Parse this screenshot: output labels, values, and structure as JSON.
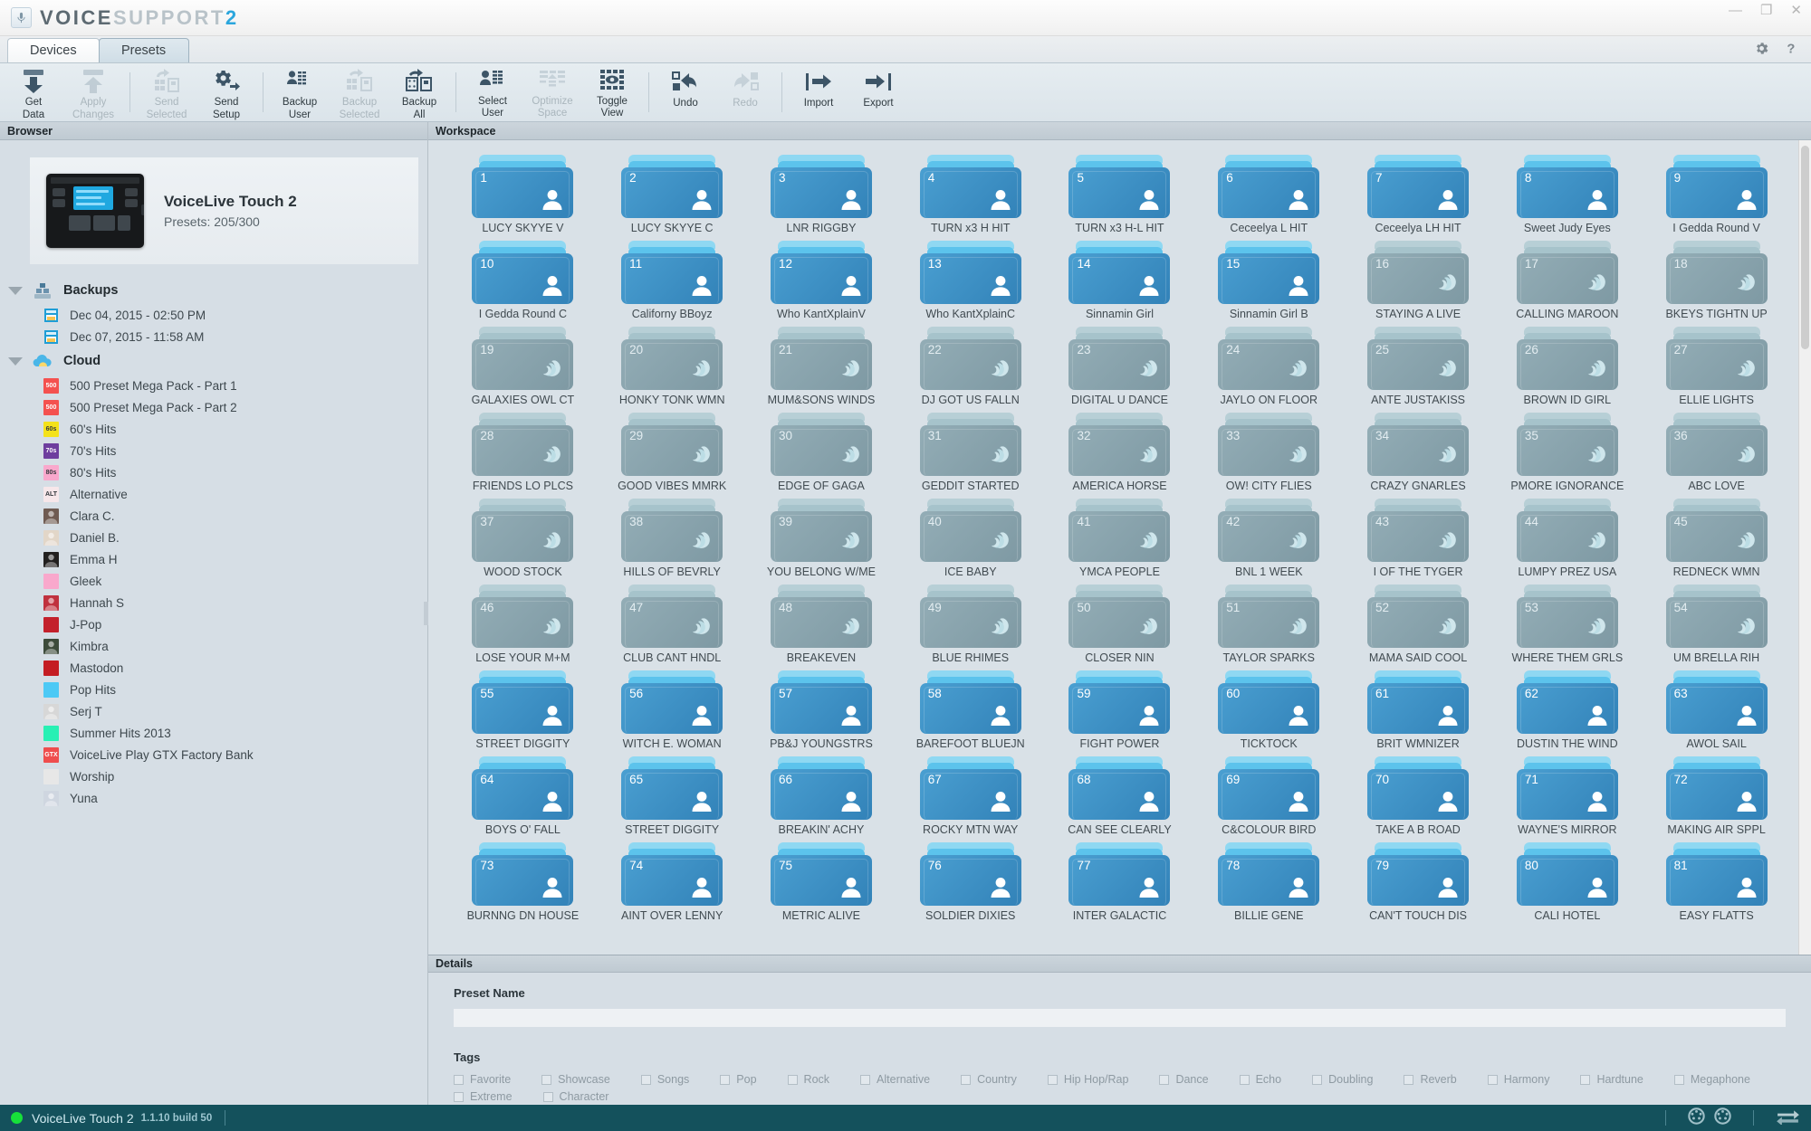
{
  "window": {
    "brand_part1": "VOICE",
    "brand_part2": "SUPPORT",
    "brand_part3": "2",
    "minimize": "—",
    "maximize": "❐",
    "close": "✕",
    "settings_icon": "gear-icon",
    "help_icon": "question-icon"
  },
  "tabs": [
    {
      "label": "Devices",
      "active": false
    },
    {
      "label": "Presets",
      "active": true
    }
  ],
  "toolbar": [
    {
      "label": "Get\nData",
      "line1": "Get",
      "line2": "Data",
      "icon": "download-icon",
      "disabled": false
    },
    {
      "label": "Apply Changes",
      "line1": "Apply",
      "line2": "Changes",
      "icon": "upload-icon",
      "disabled": true
    },
    {
      "sep": true
    },
    {
      "line1": "Send",
      "line2": "Selected",
      "icon": "send-selected-icon",
      "disabled": true
    },
    {
      "line1": "Send",
      "line2": "Setup",
      "icon": "send-setup-gear-icon",
      "disabled": false
    },
    {
      "sep": true
    },
    {
      "line1": "Backup",
      "line2": "User",
      "icon": "backup-user-icon",
      "disabled": false
    },
    {
      "line1": "Backup",
      "line2": "Selected",
      "icon": "backup-selected-icon",
      "disabled": true
    },
    {
      "line1": "Backup",
      "line2": "All",
      "icon": "backup-all-icon",
      "disabled": false
    },
    {
      "sep": true
    },
    {
      "line1": "Select",
      "line2": "User",
      "icon": "select-user-icon",
      "disabled": false
    },
    {
      "line1": "Optimize",
      "line2": "Space",
      "icon": "optimize-space-icon",
      "disabled": true
    },
    {
      "line1": "Toggle",
      "line2": "View",
      "icon": "toggle-view-eye-icon",
      "disabled": false
    },
    {
      "sep": true
    },
    {
      "line1": "Undo",
      "line2": "",
      "icon": "undo-icon",
      "disabled": false
    },
    {
      "line1": "Redo",
      "line2": "",
      "icon": "redo-icon",
      "disabled": true
    },
    {
      "sep": true
    },
    {
      "line1": "Import",
      "line2": "",
      "icon": "import-icon",
      "disabled": false
    },
    {
      "line1": "Export",
      "line2": "",
      "icon": "export-icon",
      "disabled": false
    }
  ],
  "browser": {
    "title": "Browser",
    "device": {
      "name": "VoiceLive Touch 2",
      "presets": "Presets: 205/300"
    },
    "groups": [
      {
        "name": "Backups",
        "icon": "backups-icon",
        "items": [
          {
            "label": "Dec 04, 2015 - 02:50 PM",
            "icon": "backup-file-icon",
            "color": "#2b9fd6"
          },
          {
            "label": "Dec 07, 2015 - 11:58 AM",
            "icon": "backup-file-icon",
            "color": "#2b9fd6"
          }
        ]
      },
      {
        "name": "Cloud",
        "icon": "cloud-icon",
        "items": [
          {
            "label": "500 Preset Mega Pack - Part 1",
            "icon": "pack-thumbnail",
            "color": "#f4514f",
            "text": "500"
          },
          {
            "label": "500 Preset Mega Pack - Part 2",
            "icon": "pack-thumbnail",
            "color": "#f4514f",
            "text": "500"
          },
          {
            "label": "60's Hits",
            "icon": "pack-thumbnail",
            "color": "#f4e21a",
            "text": "60s"
          },
          {
            "label": "70's Hits",
            "icon": "pack-thumbnail",
            "color": "#6e3e9e",
            "text": "70s"
          },
          {
            "label": "80's Hits",
            "icon": "pack-thumbnail",
            "color": "#f9a8cc",
            "text": "80s"
          },
          {
            "label": "Alternative",
            "icon": "pack-thumbnail",
            "color": "#f7e7ea",
            "text": "ALT"
          },
          {
            "label": "Clara C.",
            "icon": "artist-thumbnail",
            "color": "#6f5b52",
            "text": ""
          },
          {
            "label": "Daniel B.",
            "icon": "artist-thumbnail",
            "color": "#e2d6c8",
            "text": ""
          },
          {
            "label": "Emma H",
            "icon": "artist-thumbnail",
            "color": "#22201f",
            "text": ""
          },
          {
            "label": "Gleek",
            "icon": "pack-thumbnail",
            "color": "#f9a8cc",
            "text": ""
          },
          {
            "label": "Hannah S",
            "icon": "artist-thumbnail",
            "color": "#c0313e",
            "text": ""
          },
          {
            "label": "J-Pop",
            "icon": "pack-thumbnail",
            "color": "#c3202b",
            "text": ""
          },
          {
            "label": "Kimbra",
            "icon": "artist-thumbnail",
            "color": "#3d4b3b",
            "text": ""
          },
          {
            "label": "Mastodon",
            "icon": "pack-thumbnail",
            "color": "#c41d23",
            "text": ""
          },
          {
            "label": "Pop Hits",
            "icon": "pack-thumbnail",
            "color": "#4cc9f5",
            "text": ""
          },
          {
            "label": "Serj T",
            "icon": "artist-thumbnail",
            "color": "#d7d7d7",
            "text": ""
          },
          {
            "label": "Summer Hits 2013",
            "icon": "pack-thumbnail",
            "color": "#27f0b4",
            "text": ""
          },
          {
            "label": "VoiceLive Play GTX Factory Bank",
            "icon": "pack-thumbnail",
            "color": "#ef4d4d",
            "text": "GTX"
          },
          {
            "label": "Worship",
            "icon": "pack-thumbnail",
            "color": "#e7e7e7",
            "text": ""
          },
          {
            "label": "Yuna",
            "icon": "artist-thumbnail",
            "color": "#cfd6e0",
            "text": ""
          }
        ]
      }
    ]
  },
  "workspace": {
    "title": "Workspace",
    "user_icon": "person-icon",
    "factory_icon": "wave-disc-icon",
    "presets": [
      {
        "n": "1",
        "name": "LUCY SKYYE V",
        "type": "user"
      },
      {
        "n": "2",
        "name": "LUCY SKYYE C",
        "type": "user"
      },
      {
        "n": "3",
        "name": "LNR RIGGBY",
        "type": "user"
      },
      {
        "n": "4",
        "name": "TURN x3 H HIT",
        "type": "user"
      },
      {
        "n": "5",
        "name": "TURN x3 H-L HIT",
        "type": "user"
      },
      {
        "n": "6",
        "name": "Ceceelya L HIT",
        "type": "user"
      },
      {
        "n": "7",
        "name": "Ceceelya LH HIT",
        "type": "user"
      },
      {
        "n": "8",
        "name": "Sweet Judy Eyes",
        "type": "user"
      },
      {
        "n": "9",
        "name": "I Gedda Round V",
        "type": "user"
      },
      {
        "n": "10",
        "name": "I Gedda Round C",
        "type": "user"
      },
      {
        "n": "11",
        "name": "Californy BBoyz",
        "type": "user"
      },
      {
        "n": "12",
        "name": "Who KantXplainV",
        "type": "user"
      },
      {
        "n": "13",
        "name": "Who KantXplainC",
        "type": "user"
      },
      {
        "n": "14",
        "name": "Sinnamin Girl",
        "type": "user"
      },
      {
        "n": "15",
        "name": "Sinnamin Girl B",
        "type": "user"
      },
      {
        "n": "16",
        "name": "STAYING A LIVE",
        "type": "factory"
      },
      {
        "n": "17",
        "name": "CALLING MAROON",
        "type": "factory"
      },
      {
        "n": "18",
        "name": "BKEYS TIGHTN UP",
        "type": "factory"
      },
      {
        "n": "19",
        "name": "GALAXIES OWL CT",
        "type": "factory"
      },
      {
        "n": "20",
        "name": "HONKY TONK WMN",
        "type": "factory"
      },
      {
        "n": "21",
        "name": "MUM&SONS WINDS",
        "type": "factory"
      },
      {
        "n": "22",
        "name": "DJ GOT US FALLN",
        "type": "factory"
      },
      {
        "n": "23",
        "name": "DIGITAL U DANCE",
        "type": "factory"
      },
      {
        "n": "24",
        "name": "JAYLO ON FLOOR",
        "type": "factory"
      },
      {
        "n": "25",
        "name": "ANTE JUSTAKISS",
        "type": "factory"
      },
      {
        "n": "26",
        "name": "BROWN ID GIRL",
        "type": "factory"
      },
      {
        "n": "27",
        "name": "ELLIE LIGHTS",
        "type": "factory"
      },
      {
        "n": "28",
        "name": "FRIENDS LO PLCS",
        "type": "factory"
      },
      {
        "n": "29",
        "name": "GOOD VIBES MMRK",
        "type": "factory"
      },
      {
        "n": "30",
        "name": "EDGE OF GAGA",
        "type": "factory"
      },
      {
        "n": "31",
        "name": "GEDDIT STARTED",
        "type": "factory"
      },
      {
        "n": "32",
        "name": "AMERICA HORSE",
        "type": "factory"
      },
      {
        "n": "33",
        "name": "OW! CITY FLIES",
        "type": "factory"
      },
      {
        "n": "34",
        "name": "CRAZY GNARLES",
        "type": "factory"
      },
      {
        "n": "35",
        "name": "PMORE IGNORANCE",
        "type": "factory"
      },
      {
        "n": "36",
        "name": "ABC LOVE",
        "type": "factory"
      },
      {
        "n": "37",
        "name": "WOOD STOCK",
        "type": "factory"
      },
      {
        "n": "38",
        "name": "HILLS OF BEVRLY",
        "type": "factory"
      },
      {
        "n": "39",
        "name": "YOU BELONG W/ME",
        "type": "factory"
      },
      {
        "n": "40",
        "name": "ICE BABY",
        "type": "factory"
      },
      {
        "n": "41",
        "name": "YMCA PEOPLE",
        "type": "factory"
      },
      {
        "n": "42",
        "name": "BNL 1 WEEK",
        "type": "factory"
      },
      {
        "n": "43",
        "name": "I OF THE TYGER",
        "type": "factory"
      },
      {
        "n": "44",
        "name": "LUMPY PREZ USA",
        "type": "factory"
      },
      {
        "n": "45",
        "name": "REDNECK WMN",
        "type": "factory"
      },
      {
        "n": "46",
        "name": "LOSE YOUR M+M",
        "type": "factory"
      },
      {
        "n": "47",
        "name": "CLUB CANT HNDL",
        "type": "factory"
      },
      {
        "n": "48",
        "name": "BREAKEVEN",
        "type": "factory"
      },
      {
        "n": "49",
        "name": "BLUE RHIMES",
        "type": "factory"
      },
      {
        "n": "50",
        "name": "CLOSER NIN",
        "type": "factory"
      },
      {
        "n": "51",
        "name": "TAYLOR SPARKS",
        "type": "factory"
      },
      {
        "n": "52",
        "name": "MAMA SAID COOL",
        "type": "factory"
      },
      {
        "n": "53",
        "name": "WHERE THEM GRLS",
        "type": "factory"
      },
      {
        "n": "54",
        "name": "UM BRELLA RIH",
        "type": "factory"
      },
      {
        "n": "55",
        "name": "STREET DIGGITY",
        "type": "user"
      },
      {
        "n": "56",
        "name": "WITCH E. WOMAN",
        "type": "user"
      },
      {
        "n": "57",
        "name": "PB&J YOUNGSTRS",
        "type": "user"
      },
      {
        "n": "58",
        "name": "BAREFOOT BLUEJN",
        "type": "user"
      },
      {
        "n": "59",
        "name": "FIGHT POWER",
        "type": "user"
      },
      {
        "n": "60",
        "name": "TICKTOCK",
        "type": "user"
      },
      {
        "n": "61",
        "name": "BRIT WMNIZER",
        "type": "user"
      },
      {
        "n": "62",
        "name": "DUSTIN THE WIND",
        "type": "user"
      },
      {
        "n": "63",
        "name": "AWOL SAIL",
        "type": "user"
      },
      {
        "n": "64",
        "name": "BOYS O' FALL",
        "type": "user"
      },
      {
        "n": "65",
        "name": "STREET DIGGITY",
        "type": "user"
      },
      {
        "n": "66",
        "name": "BREAKIN' ACHY",
        "type": "user"
      },
      {
        "n": "67",
        "name": "ROCKY MTN WAY",
        "type": "user"
      },
      {
        "n": "68",
        "name": "CAN SEE CLEARLY",
        "type": "user"
      },
      {
        "n": "69",
        "name": "C&COLOUR BIRD",
        "type": "user"
      },
      {
        "n": "70",
        "name": "TAKE A B ROAD",
        "type": "user"
      },
      {
        "n": "71",
        "name": "WAYNE'S MIRROR",
        "type": "user"
      },
      {
        "n": "72",
        "name": "MAKING AIR SPPL",
        "type": "user"
      },
      {
        "n": "73",
        "name": "BURNNG DN HOUSE",
        "type": "user"
      },
      {
        "n": "74",
        "name": "AINT OVER LENNY",
        "type": "user"
      },
      {
        "n": "75",
        "name": "METRIC ALIVE",
        "type": "user"
      },
      {
        "n": "76",
        "name": "SOLDIER DIXIES",
        "type": "user"
      },
      {
        "n": "77",
        "name": "INTER GALACTIC",
        "type": "user"
      },
      {
        "n": "78",
        "name": "BILLIE GENE",
        "type": "user"
      },
      {
        "n": "79",
        "name": "CAN'T TOUCH DIS",
        "type": "user"
      },
      {
        "n": "80",
        "name": "CALI HOTEL",
        "type": "user"
      },
      {
        "n": "81",
        "name": "EASY FLATTS",
        "type": "user"
      }
    ]
  },
  "details": {
    "title": "Details",
    "preset_name_label": "Preset Name",
    "preset_name_value": "",
    "preset_name_placeholder": "",
    "tags_label": "Tags",
    "tags_row1": [
      "Favorite",
      "Showcase",
      "Songs",
      "Pop",
      "Rock",
      "Alternative",
      "Country",
      "Hip Hop/Rap",
      "Dance",
      "Echo",
      "Doubling",
      "Reverb",
      "Harmony",
      "Hardtune",
      "Megaphone"
    ],
    "tags_row2": [
      "Extreme",
      "Character"
    ]
  },
  "statusbar": {
    "device": "VoiceLive Touch 2",
    "version": "1.1.10 build 50",
    "midi_in_icon": "midi-din-icon",
    "midi_out_icon": "midi-din-icon",
    "transfer_icon": "transfer-arrows-icon"
  },
  "colors": {
    "accent": "#2ba6dd",
    "user_card": "#3b8fc4",
    "factory_card": "#8ba6b0",
    "status_bg": "#14515c",
    "status_dot": "#17e03a"
  }
}
